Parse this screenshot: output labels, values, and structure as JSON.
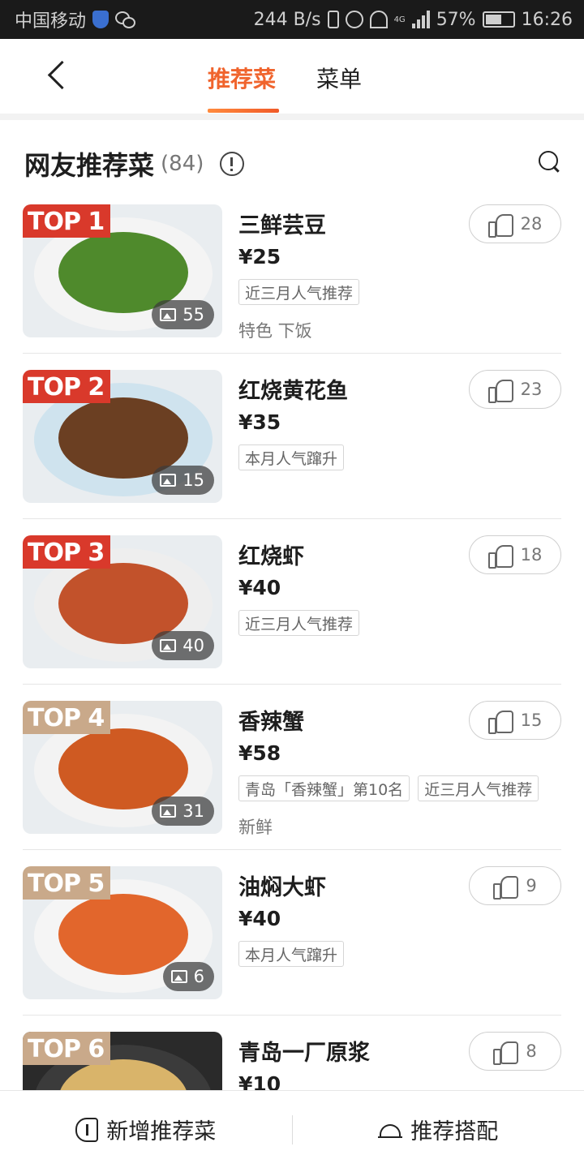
{
  "status_bar": {
    "carrier": "中国移动",
    "network_speed": "244 B/s",
    "signal_label": "4G",
    "battery": "57%",
    "time": "16:26"
  },
  "header": {
    "tabs": [
      {
        "label": "推荐菜",
        "active": true
      },
      {
        "label": "菜单",
        "active": false
      }
    ],
    "accent_color": "#f0642d"
  },
  "section": {
    "title": "网友推荐菜",
    "count": "(84)"
  },
  "dishes": [
    {
      "rank": "TOP 1",
      "name": "三鲜芸豆",
      "price": "¥25",
      "photos": "55",
      "likes": "28",
      "tags": [
        "近三月人气推荐"
      ],
      "extra": "特色  下饭",
      "plate": "#f4f4f4",
      "food": "#4f8a2c"
    },
    {
      "rank": "TOP 2",
      "name": "红烧黄花鱼",
      "price": "¥35",
      "photos": "15",
      "likes": "23",
      "tags": [
        "本月人气蹿升"
      ],
      "extra": "",
      "plate": "#cfe3ee",
      "food": "#6b3f22"
    },
    {
      "rank": "TOP 3",
      "name": "红烧虾",
      "price": "¥40",
      "photos": "40",
      "likes": "18",
      "tags": [
        "近三月人气推荐"
      ],
      "extra": "",
      "plate": "#eeeeee",
      "food": "#c2522b"
    },
    {
      "rank": "TOP 4",
      "name": "香辣蟹",
      "price": "¥58",
      "photos": "31",
      "likes": "15",
      "tags": [
        "青岛「香辣蟹」第10名",
        "近三月人气推荐"
      ],
      "extra": "新鲜",
      "plate": "#f3f3f3",
      "food": "#cf5a22"
    },
    {
      "rank": "TOP 5",
      "name": "油焖大虾",
      "price": "¥40",
      "photos": "6",
      "likes": "9",
      "tags": [
        "本月人气蹿升"
      ],
      "extra": "",
      "plate": "#f5f5f5",
      "food": "#e2662c"
    },
    {
      "rank": "TOP 6",
      "name": "青岛一厂原浆",
      "price": "¥10",
      "photos": "",
      "likes": "8",
      "tags": [],
      "extra": "",
      "plate": "#3b3b3b",
      "food": "#d9b46a"
    }
  ],
  "bottom_bar": {
    "add_label": "新增推荐菜",
    "combo_label": "推荐搭配"
  }
}
